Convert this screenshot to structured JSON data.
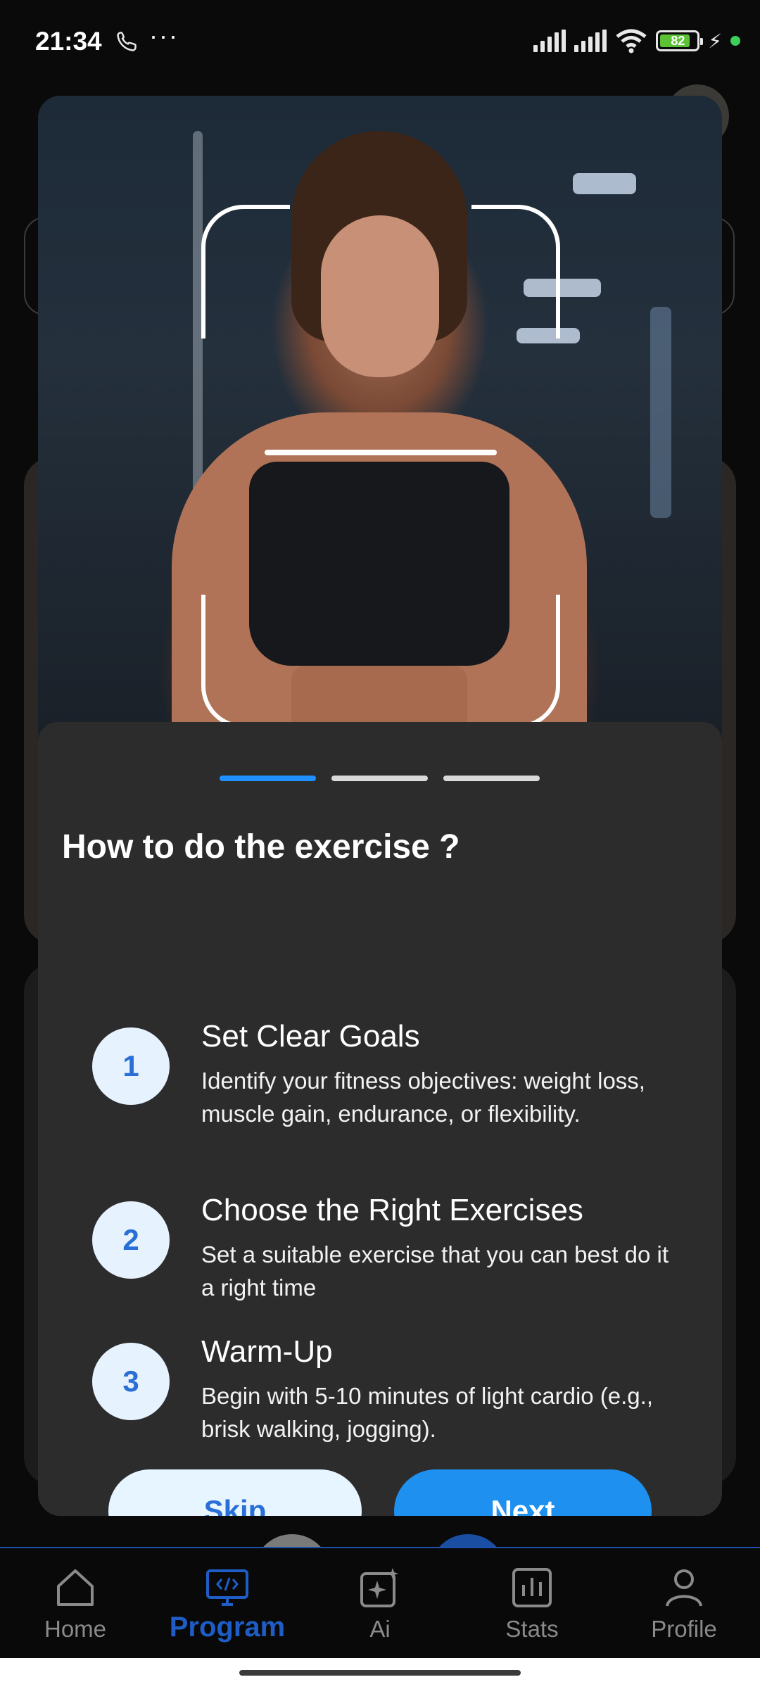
{
  "status_bar": {
    "time": "21:34",
    "more": "···",
    "battery": "82",
    "icons": [
      "call-icon",
      "signal-icon",
      "signal-icon",
      "wifi-icon",
      "battery-icon",
      "charging-icon"
    ]
  },
  "modal": {
    "heading": "How to do the exercise ?",
    "pagination": {
      "total": 3,
      "active": 1
    },
    "steps": [
      {
        "number": "1",
        "title": "Set Clear Goals",
        "desc": "Identify your fitness objectives: weight loss, muscle gain, endurance, or flexibility."
      },
      {
        "number": "2",
        "title": "Choose the Right Exercises",
        "desc": "Set a suitable exercise that you can best do it a right time"
      },
      {
        "number": "3",
        "title": "Warm-Up",
        "desc": "Begin with 5-10 minutes of light cardio (e.g., brisk walking, jogging)."
      }
    ],
    "skip_label": "Skip",
    "next_label": "Next"
  },
  "nav": {
    "items": [
      {
        "label": "Home",
        "icon": "home-icon"
      },
      {
        "label": "Program",
        "icon": "program-icon",
        "active": true
      },
      {
        "label": "Ai",
        "icon": "ai-icon"
      },
      {
        "label": "Stats",
        "icon": "stats-icon"
      },
      {
        "label": "Profile",
        "icon": "profile-icon"
      }
    ]
  },
  "colors": {
    "accent": "#1e90f0",
    "active_nav": "#1f5dc6",
    "panel": "#2c2c2c"
  }
}
